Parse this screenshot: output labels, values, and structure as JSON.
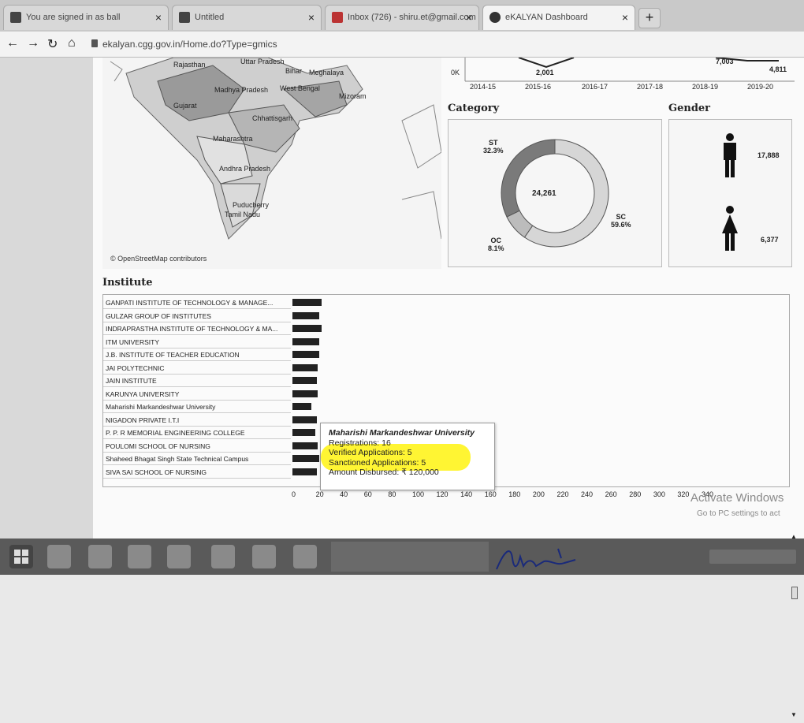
{
  "browser": {
    "tabs": [
      {
        "label": "You are signed in as ball",
        "active": false
      },
      {
        "label": "Untitled",
        "active": false
      },
      {
        "label": "Inbox (726) - shiru.et@gmail.com",
        "active": false
      },
      {
        "label": "eKALYAN Dashboard",
        "active": true
      }
    ],
    "url": "ekalyan.cgg.gov.in/Home.do?Type=gmics"
  },
  "map": {
    "labels": [
      "Rajasthan",
      "Uttar Pradesh",
      "Bihar",
      "Meghalaya",
      "Madhya Pradesh",
      "West Bengal",
      "Mizoram",
      "Gujarat",
      "Chhattisgarh",
      "Maharashtra",
      "Andhra Pradesh",
      "Puducherry",
      "Tamil Nadu"
    ],
    "credit": "© OpenStreetMap contributors"
  },
  "trend": {
    "years": [
      "2014-15",
      "2015-16",
      "2016-17",
      "2017-18",
      "2018-19",
      "2019-20"
    ],
    "point_labels": [
      "2,001",
      "7,003",
      "4,811"
    ],
    "axis_zero": "0K"
  },
  "category": {
    "title": "Category",
    "center_total": "24,261",
    "slices": [
      {
        "name": "SC",
        "percent_label": "59.6%",
        "value": 59.6,
        "color": "#d6d6d6"
      },
      {
        "name": "OC",
        "percent_label": "8.1%",
        "value": 8.1,
        "color": "#bcbcbc"
      },
      {
        "name": "ST",
        "percent_label": "32.3%",
        "value": 32.3,
        "color": "#7a7a7a"
      }
    ]
  },
  "gender": {
    "title": "Gender",
    "male": "17,888",
    "female": "6,377"
  },
  "institute": {
    "title": "Institute",
    "rows": [
      {
        "name": "GANPATI INSTITUTE OF TECHNOLOGY & MANAGE...",
        "value": 24
      },
      {
        "name": "GULZAR GROUP OF INSTITUTES",
        "value": 22
      },
      {
        "name": "INDRAPRASTHA INSTITUTE OF TECHNOLOGY & MA...",
        "value": 24
      },
      {
        "name": "ITM UNIVERSITY",
        "value": 22
      },
      {
        "name": "J.B. INSTITUTE OF TEACHER EDUCATION",
        "value": 22
      },
      {
        "name": "JAI POLYTECHNIC",
        "value": 21
      },
      {
        "name": "JAIN INSTITUTE",
        "value": 20
      },
      {
        "name": "KARUNYA UNIVERSITY",
        "value": 21
      },
      {
        "name": "Maharishi Markandeshwar University",
        "value": 16
      },
      {
        "name": "NIGADON PRIVATE I.T.I",
        "value": 20
      },
      {
        "name": "P. P. R MEMORIAL ENGINEERING COLLEGE",
        "value": 19
      },
      {
        "name": "POULOMI SCHOOL OF NURSING",
        "value": 21
      },
      {
        "name": "Shaheed Bhagat Singh State Technical Campus",
        "value": 22
      },
      {
        "name": "SIVA SAI SCHOOL OF NURSING",
        "value": 20
      }
    ],
    "axis_ticks": [
      "0",
      "20",
      "40",
      "60",
      "80",
      "100",
      "120",
      "140",
      "160",
      "180",
      "200",
      "220",
      "240",
      "260",
      "280",
      "300",
      "320",
      "340"
    ],
    "axis_max": 340
  },
  "tooltip": {
    "title": "Maharishi Markandeshwar University",
    "registrations": "Registrations: 16",
    "verified": "Verified Applications: 5",
    "sanctioned": "Sanctioned Applications: 5",
    "amount": "Amount Disbursed: ₹ 120,000"
  },
  "watermark": {
    "title": "Activate Windows",
    "subtitle": "Go to PC settings to act"
  }
}
